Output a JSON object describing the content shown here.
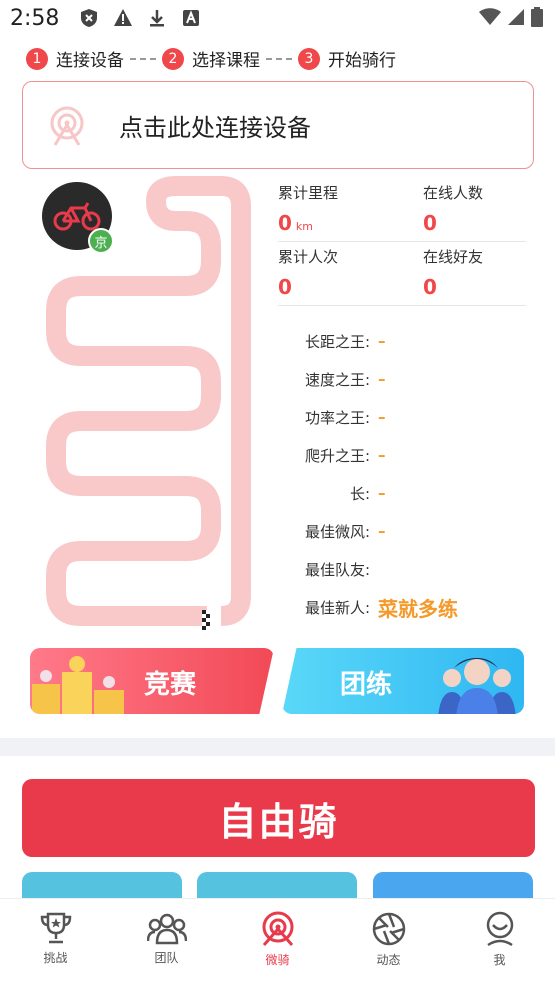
{
  "status_bar": {
    "time": "2:58"
  },
  "steps": [
    {
      "num": "1",
      "label": "连接设备"
    },
    {
      "num": "2",
      "label": "选择课程"
    },
    {
      "num": "3",
      "label": "开始骑行"
    }
  ],
  "connect": {
    "text": "点击此处连接设备"
  },
  "avatar_badge": "京",
  "stats": {
    "total_distance": {
      "label": "累计里程",
      "value": "0",
      "unit": "km"
    },
    "online_users": {
      "label": "在线人数",
      "value": "0"
    },
    "total_rides": {
      "label": "累计人次",
      "value": "0"
    },
    "online_friends": {
      "label": "在线好友",
      "value": "0"
    }
  },
  "kings": [
    {
      "label": "长距之王:",
      "value": "–"
    },
    {
      "label": "速度之王:",
      "value": "–"
    },
    {
      "label": "功率之王:",
      "value": "–"
    },
    {
      "label": "爬升之王:",
      "value": "–"
    },
    {
      "label": "长:",
      "value": "–"
    },
    {
      "label": "最佳微风:",
      "value": "–"
    },
    {
      "label": "最佳队友:",
      "value": ""
    },
    {
      "label": "最佳新人:",
      "value": "菜就多练"
    }
  ],
  "banners": {
    "race": "竞赛",
    "team": "团练"
  },
  "free_ride": "自由骑",
  "tabs": [
    {
      "label": "挑战",
      "icon": "trophy-icon",
      "active": false
    },
    {
      "label": "团队",
      "icon": "team-icon",
      "active": false
    },
    {
      "label": "微骑",
      "icon": "ride-icon",
      "active": true
    },
    {
      "label": "动态",
      "icon": "aperture-icon",
      "active": false
    },
    {
      "label": "我",
      "icon": "profile-icon",
      "active": false
    }
  ],
  "colors": {
    "accent": "#e83a4a",
    "gold": "#f39a2b",
    "track": "#f9c9c9",
    "team_blue": "#2fb7f2"
  }
}
